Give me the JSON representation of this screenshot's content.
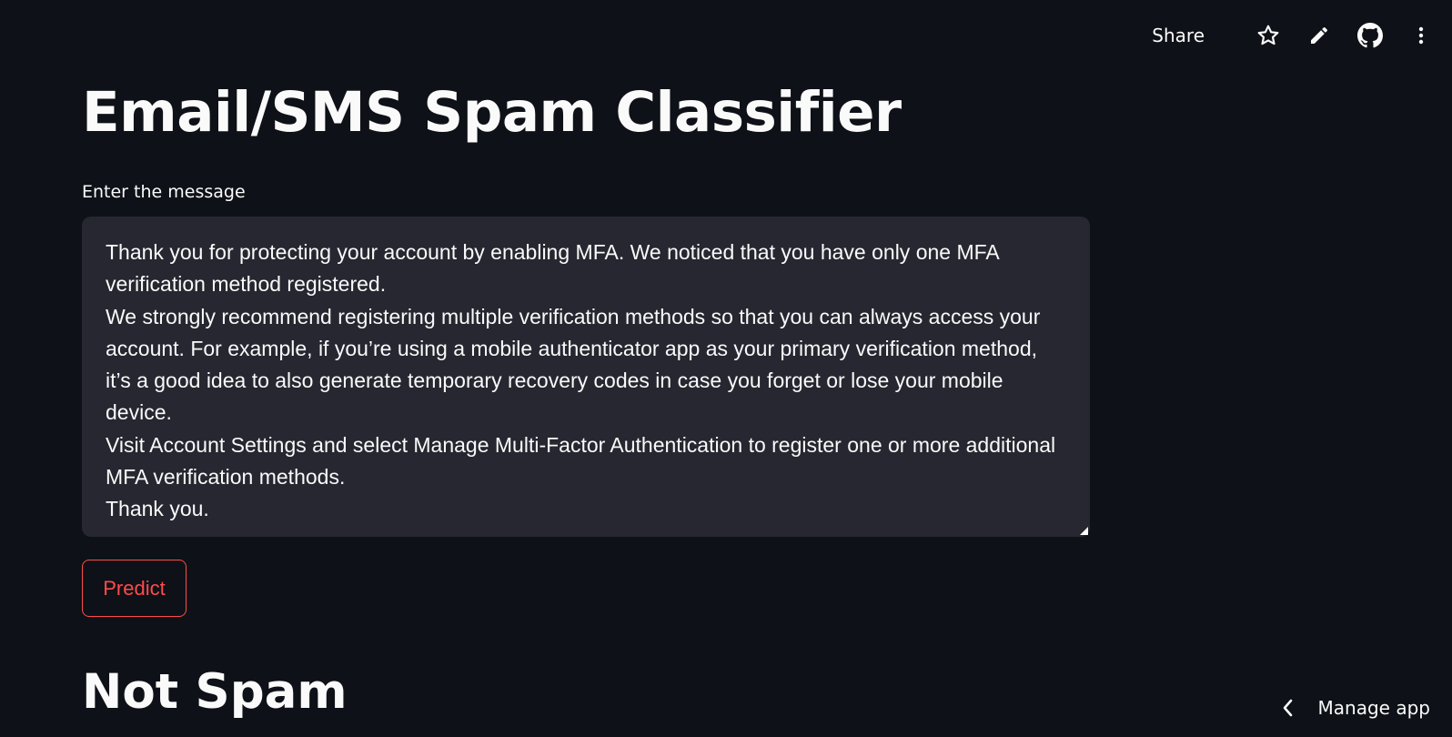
{
  "toolbar": {
    "share_label": "Share",
    "icons": [
      "star-icon",
      "pencil-icon",
      "github-icon",
      "more-vertical-icon"
    ]
  },
  "main": {
    "title": "Email/SMS Spam Classifier",
    "input_label": "Enter the message",
    "message_value": "Thank you for protecting your account by enabling MFA. We noticed that you have only one MFA verification method registered.\nWe strongly recommend registering multiple verification methods so that you can always access your account. For example, if you’re using a mobile authenticator app as your primary verification method, it’s a good idea to also generate temporary recovery codes in case you forget or lose your mobile device.\nVisit Account Settings and select Manage Multi-Factor Authentication to register one or more additional MFA verification methods.\nThank you.",
    "predict_label": "Predict",
    "result": "Not Spam"
  },
  "footer": {
    "manage_app_label": "Manage app"
  },
  "colors": {
    "background": "#0e1117",
    "textarea_bg": "#262730",
    "accent": "#ff4b4b",
    "text": "#fafafa"
  }
}
